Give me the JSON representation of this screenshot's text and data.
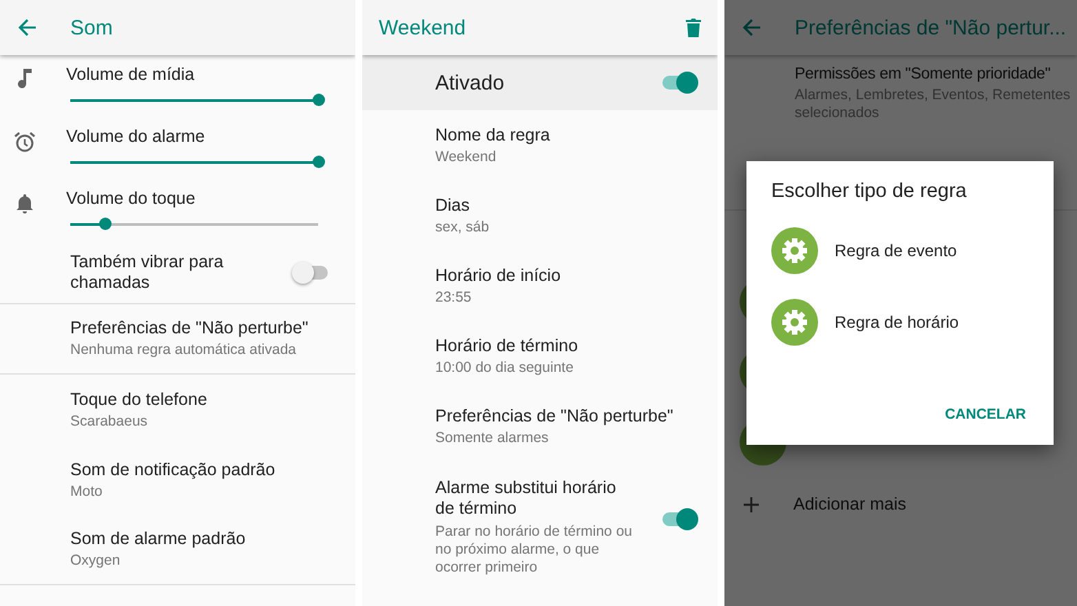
{
  "sound_screen": {
    "title": "Som",
    "rows": [
      {
        "kind": "slider",
        "label": "Volume de mídia",
        "level": 1.0
      },
      {
        "kind": "slider",
        "label": "Volume do alarme",
        "level": 1.0
      },
      {
        "kind": "slider",
        "label": "Volume do toque",
        "level": 0.14
      },
      {
        "kind": "toggle",
        "label": "Também vibrar para chamadas",
        "on": false,
        "divider_after": true
      },
      {
        "kind": "link",
        "title": "Preferências de \"Não perturbe\"",
        "subtitle": "Nenhuma regra automática ativada",
        "divider_after": true
      },
      {
        "kind": "link",
        "title": "Toque do telefone",
        "subtitle": "Scarabaeus",
        "divider_after": false
      },
      {
        "kind": "link",
        "title": "Som de notificação padrão",
        "subtitle": "Moto",
        "divider_after": false
      },
      {
        "kind": "link",
        "title": "Som de alarme padrão",
        "subtitle": "Oxygen",
        "divider_after": true
      }
    ]
  },
  "rule_screen": {
    "title": "Weekend",
    "master_switch": {
      "label": "Ativado",
      "on": true
    },
    "rows": [
      {
        "kind": "link",
        "title": "Nome da regra",
        "subtitle": "Weekend"
      },
      {
        "kind": "link",
        "title": "Dias",
        "subtitle": "sex, sáb"
      },
      {
        "kind": "link",
        "title": "Horário de início",
        "subtitle": "23:55"
      },
      {
        "kind": "link",
        "title": "Horário de término",
        "subtitle": "10:00 do dia seguinte"
      },
      {
        "kind": "link",
        "title": "Preferências de \"Não perturbe\"",
        "subtitle": "Somente alarmes"
      },
      {
        "kind": "toggle",
        "title": "Alarme substitui horário de término",
        "subtitle": "Parar no horário de término ou no próximo alarme, o que ocorrer primeiro",
        "on": true
      }
    ]
  },
  "dnd_screen": {
    "title": "Preferências de \"Não pertur...",
    "items": [
      {
        "title": "Permissões em \"Somente prioridade\"",
        "subtitle": "Alarmes, Lembretes, Eventos, Remetentes selecionados"
      }
    ],
    "add_label": "Adicionar mais",
    "dialog": {
      "title": "Escolher tipo de regra",
      "options": [
        {
          "label": "Regra de evento"
        },
        {
          "label": "Regra de horário"
        }
      ],
      "button": "CANCELAR"
    }
  }
}
